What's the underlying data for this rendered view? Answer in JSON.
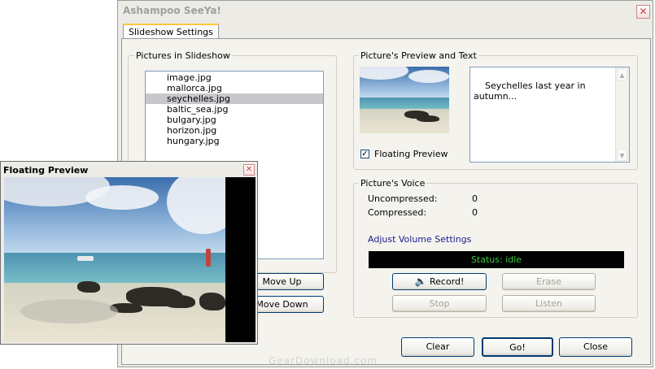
{
  "window": {
    "title": "Ashampoo SeeYa!",
    "close_glyph": "✕"
  },
  "tabs": [
    {
      "label": "Slideshow Settings"
    }
  ],
  "pictures": {
    "group_label": "Pictures in Slideshow",
    "items": [
      "image.jpg",
      "mallorca.jpg",
      "seychelles.jpg",
      "baltic_sea.jpg",
      "bulgary.jpg",
      "horizon.jpg",
      "hungary.jpg"
    ],
    "selected_index": 2
  },
  "reorder": {
    "move_up_label": "Move Up",
    "move_down_label": "Move Down"
  },
  "preview": {
    "group_label": "Picture's Preview and Text",
    "caption": "Seychelles last year in\nautumn...",
    "floating_checkbox_label": "Floating Preview",
    "floating_checked": true
  },
  "voice": {
    "group_label": "Picture's Voice",
    "uncompressed_label": "Uncompressed:",
    "uncompressed_value": "0",
    "compressed_label": "Compressed:",
    "compressed_value": "0",
    "volume_link": "Adjust Volume Settings",
    "status": "Status: idle",
    "record_label": "Record!",
    "erase_label": "Erase",
    "stop_label": "Stop",
    "listen_label": "Listen"
  },
  "footer": {
    "clear_label": "Clear",
    "go_label": "Go!",
    "close_label": "Close"
  },
  "floating_window": {
    "title": "Floating Preview",
    "close_glyph": "✕"
  },
  "watermark": "GearDownload.com",
  "colors": {
    "status_bg": "#000000",
    "status_text": "#3cc63c",
    "link": "#1a1a8c",
    "accent_tab": "#ffc83c"
  }
}
